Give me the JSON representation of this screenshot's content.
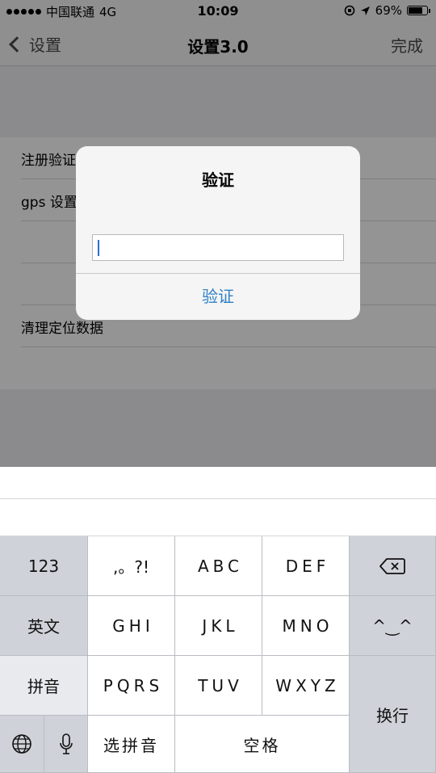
{
  "status_bar": {
    "carrier": "中国联通",
    "network": "4G",
    "time": "10:09",
    "battery_percent": "69%",
    "battery_level": 0.69
  },
  "nav": {
    "back_label": "设置",
    "title": "设置3.0",
    "done_label": "完成"
  },
  "settings": {
    "rows": [
      {
        "label": "注册验证"
      },
      {
        "label": "gps 设置"
      },
      {
        "label": ""
      },
      {
        "label": ""
      },
      {
        "label": "清理定位数据"
      }
    ]
  },
  "alert": {
    "title": "验证",
    "input_value": "",
    "button_label": "验证"
  },
  "keyboard": {
    "keys": {
      "numbers": "123",
      "punct": ",。?!",
      "abc": "ABC",
      "def": "DEF",
      "english": "英文",
      "ghi": "GHI",
      "jkl": "JKL",
      "mno": "MNO",
      "emoji": "^‿^",
      "pinyin": "拼音",
      "pqrs": "PQRS",
      "tuv": "TUV",
      "wxyz": "WXYZ",
      "return": "换行",
      "select_pinyin": "选拼音",
      "space": "空格"
    },
    "icons": {
      "globe": "globe-icon",
      "mic": "microphone-icon",
      "delete": "delete-icon"
    }
  }
}
